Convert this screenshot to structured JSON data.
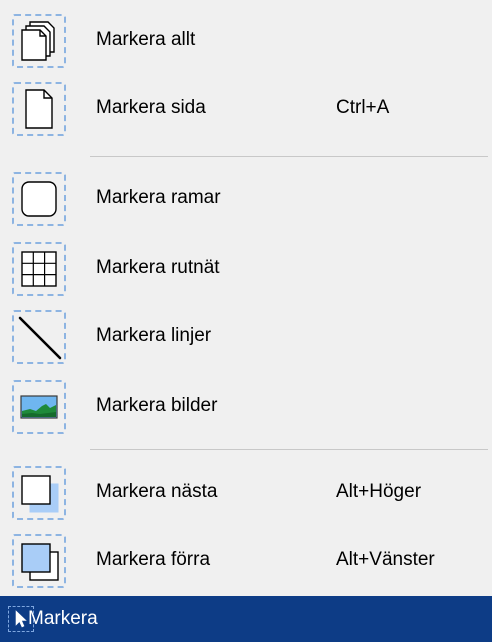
{
  "menu": {
    "items": [
      {
        "label": "Markera allt",
        "shortcut": "",
        "icon": "pages-stack-icon"
      },
      {
        "label": "Markera sida",
        "shortcut": "Ctrl+A",
        "icon": "page-icon"
      },
      {
        "label": "Markera ramar",
        "shortcut": "",
        "icon": "rounded-frame-icon"
      },
      {
        "label": "Markera rutnät",
        "shortcut": "",
        "icon": "grid-icon"
      },
      {
        "label": "Markera linjer",
        "shortcut": "",
        "icon": "line-icon"
      },
      {
        "label": "Markera bilder",
        "shortcut": "",
        "icon": "image-icon"
      },
      {
        "label": "Markera nästa",
        "shortcut": "Alt+Höger",
        "icon": "next-frame-icon"
      },
      {
        "label": "Markera förra",
        "shortcut": "Alt+Vänster",
        "icon": "previous-frame-icon"
      }
    ]
  },
  "bar": {
    "label": "Markera",
    "icon": "cursor-arrow-icon"
  },
  "colors": {
    "bar_bg": "#0d3c86",
    "dash": "#8db4e2",
    "menu_bg": "#f0f0f0",
    "frame_fill": "#a9cdf7"
  }
}
